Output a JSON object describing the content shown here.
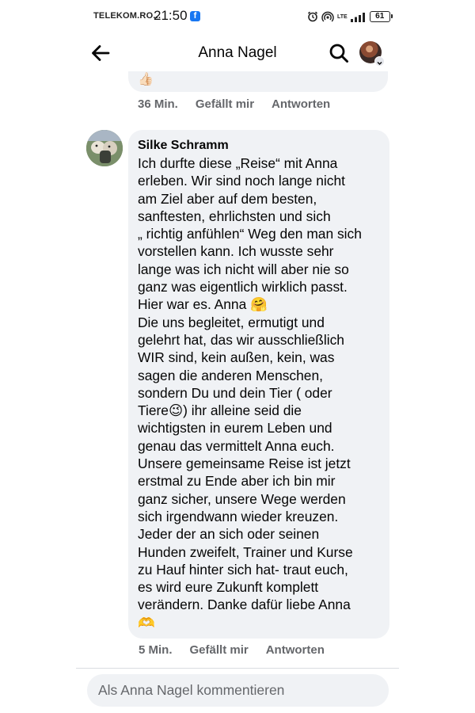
{
  "status_bar": {
    "carrier": "TELEKOM.RO...",
    "time": "21:50",
    "network_label": "LTE",
    "battery": "61"
  },
  "header": {
    "title": "Anna Nagel"
  },
  "previous_comment": {
    "emoji": "👍🏻",
    "time": "36 Min.",
    "like_label": "Gefällt mir",
    "reply_label": "Antworten"
  },
  "comment": {
    "author": "Silke Schramm",
    "lines": [
      "Ich durfte diese „Reise“ mit Anna",
      "erleben. Wir sind noch lange nicht",
      "am Ziel aber auf dem besten,",
      "sanftesten, ehrlichsten und sich",
      "„ richtig anfühlen“ Weg den man sich",
      "vorstellen kann. Ich wusste sehr",
      "lange was ich nicht will aber nie so",
      "ganz was eigentlich wirklich passt.",
      "Hier war es. Anna 🤗",
      "Die uns begleitet, ermutigt und",
      "gelehrt hat, das wir ausschließlich",
      "WIR sind, kein außen, kein, was",
      "sagen die anderen Menschen,",
      "sondern Du und dein Tier ( oder",
      "Tiere😉) ihr alleine seid die",
      "wichtigsten in eurem Leben und",
      "genau das vermittelt Anna euch.",
      "Unsere gemeinsame Reise ist jetzt",
      "erstmal zu Ende aber ich bin mir",
      "ganz sicher, unsere Wege werden",
      "sich irgendwann wieder kreuzen.",
      "Jeder der an sich oder seinen",
      "Hunden zweifelt, Trainer und Kurse",
      "zu Hauf hinter sich hat- traut euch,",
      "es wird eure Zukunft komplett",
      "verändern. Danke dafür liebe Anna",
      "🫶"
    ],
    "time": "5 Min.",
    "like_label": "Gefällt mir",
    "reply_label": "Antworten"
  },
  "composer": {
    "placeholder": "Als Anna Nagel kommentieren"
  },
  "icons": {
    "back": "arrow-left-icon",
    "search": "search-icon",
    "profile": "avatar-icon",
    "alarm": "alarm-icon",
    "hotspot": "hotspot-icon",
    "signal": "signal-icon",
    "facebook": "facebook-icon"
  },
  "colors": {
    "bubble": "#f0f2f5",
    "meta_text": "#65676b",
    "facebook_blue": "#1877f2"
  }
}
